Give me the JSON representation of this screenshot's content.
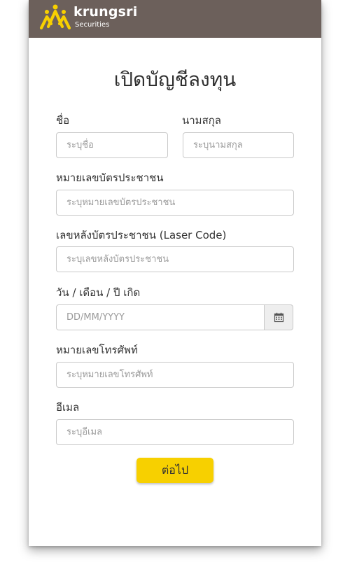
{
  "brand": {
    "name": "krungsri",
    "subtitle": "Securities",
    "header_color": "#6c605b",
    "logo_color": "#f7d000"
  },
  "form": {
    "title": "เปิดบัญชีลงทุน",
    "first_name": {
      "label": "ชื่อ",
      "placeholder": "ระบุชื่อ",
      "value": ""
    },
    "last_name": {
      "label": "นามสกุล",
      "placeholder": "ระบุนามสกุล",
      "value": ""
    },
    "id_number": {
      "label": "หมายเลขบัตรประชาชน",
      "placeholder": "ระบุหมายเลขบัตรประชาชน",
      "value": ""
    },
    "laser_code": {
      "label": "เลขหลังบัตรประชาชน (Laser Code)",
      "placeholder": "ระบุเลขหลังบัตรประชาชน",
      "value": ""
    },
    "birth_date": {
      "label": "วัน / เดือน / ปี เกิด",
      "placeholder": "DD/MM/YYYY",
      "value": "",
      "calendar_icon": "calendar-icon"
    },
    "phone": {
      "label": "หมายเลขโทรศัพท์",
      "placeholder": "ระบุหมายเลขโทรศัพท์",
      "value": ""
    },
    "email": {
      "label": "อีเมล",
      "placeholder": "ระบุอีเมล",
      "value": ""
    },
    "next_button": {
      "label": "ต่อไป",
      "color": "#f7d000"
    }
  }
}
